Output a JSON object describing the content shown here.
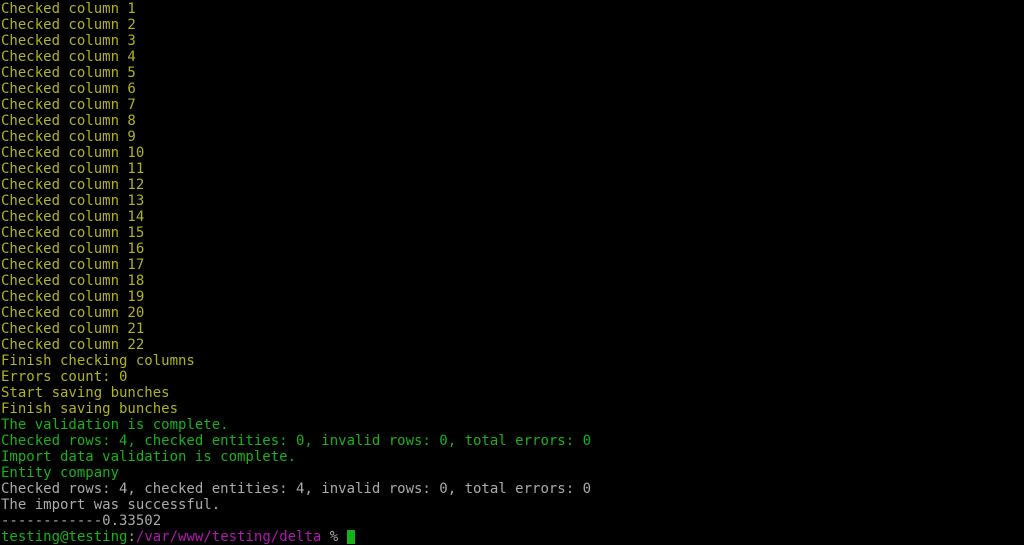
{
  "yellow_lines": [
    "Checked column 1",
    "Checked column 2",
    "Checked column 3",
    "Checked column 4",
    "Checked column 5",
    "Checked column 6",
    "Checked column 7",
    "Checked column 8",
    "Checked column 9",
    "Checked column 10",
    "Checked column 11",
    "Checked column 12",
    "Checked column 13",
    "Checked column 14",
    "Checked column 15",
    "Checked column 16",
    "Checked column 17",
    "Checked column 18",
    "Checked column 19",
    "Checked column 20",
    "Checked column 21",
    "Checked column 22",
    "Finish checking columns",
    "Errors count: 0",
    "Start saving bunches",
    "Finish saving bunches"
  ],
  "green_lines": [
    "The validation is complete.",
    "Checked rows: 4, checked entities: 0, invalid rows: 0, total errors: 0",
    "Import data validation is complete.",
    "Entity company"
  ],
  "gray_lines": [
    "Checked rows: 4, checked entities: 4, invalid rows: 0, total errors: 0",
    "The import was successful.",
    "------------0.33502"
  ],
  "prompt": {
    "user": "testing",
    "at": "@",
    "host": "testing",
    "colon": ":",
    "path": "/var/www/testing/delta",
    "percent": " % "
  }
}
